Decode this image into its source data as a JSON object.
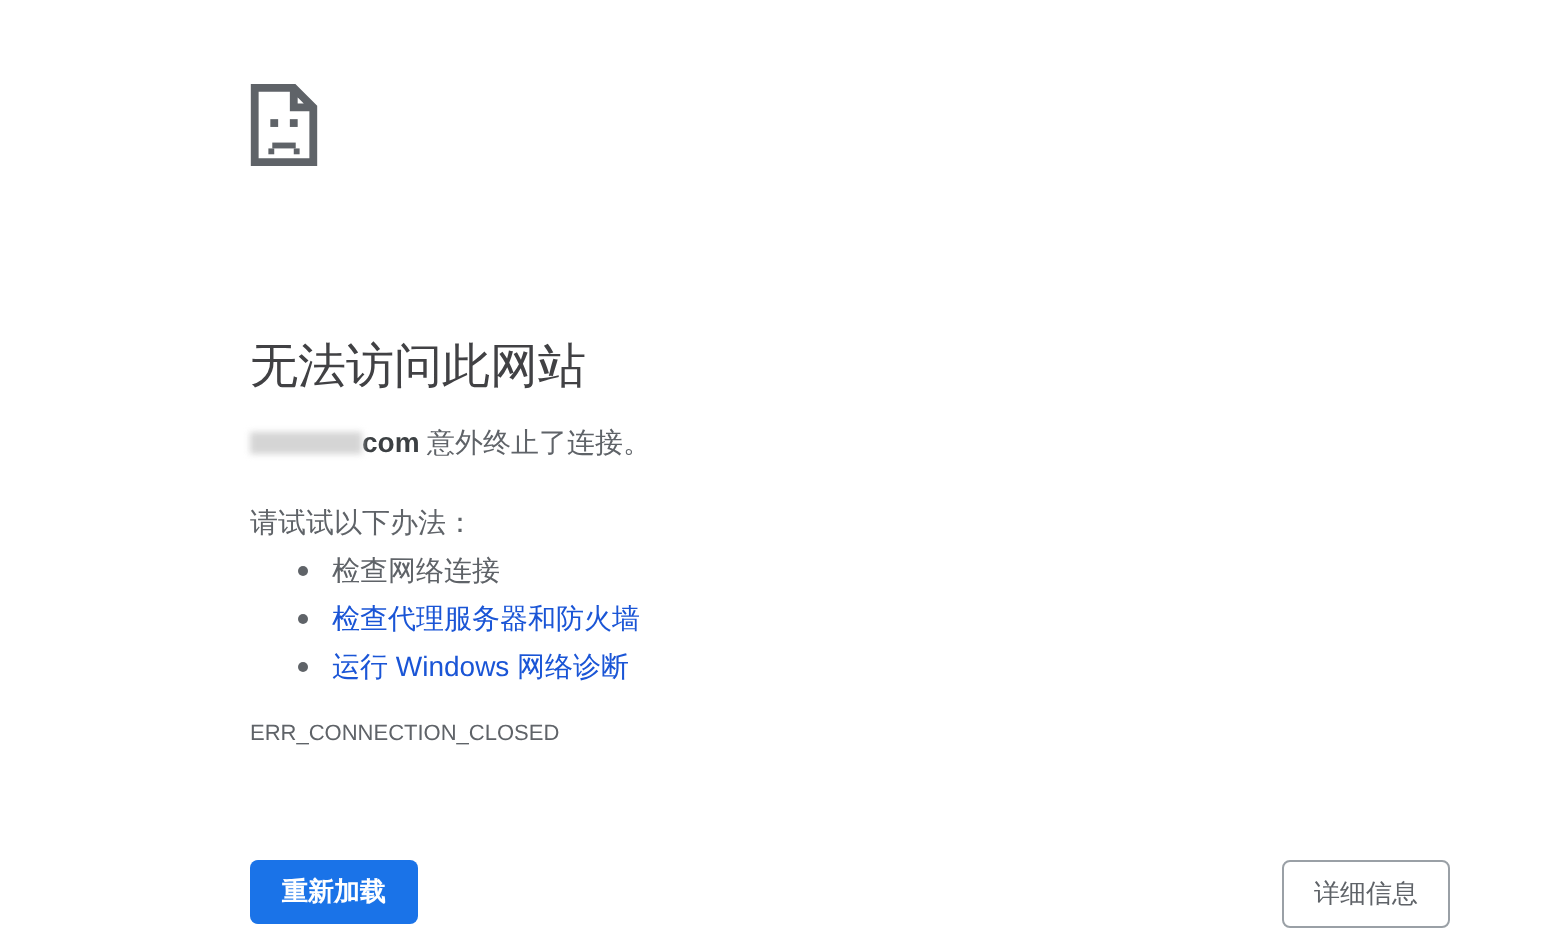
{
  "heading": "无法访问此网站",
  "message": "**com** 意外终止了连接。",
  "suggestions_intro": "请试试以下办法：",
  "suggestions": [
    {
      "kind": "text",
      "text": "检查网络连接"
    },
    {
      "kind": "link",
      "text": "检查代理服务器和防火墙"
    },
    {
      "kind": "link",
      "text": "运行 Windows 网络诊断"
    }
  ],
  "error_code": "ERR_CONNECTION_CLOSED",
  "buttons": {
    "reload": "重新加载",
    "details": "详细信息"
  }
}
